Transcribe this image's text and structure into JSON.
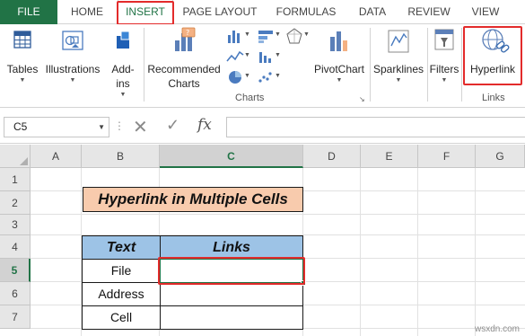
{
  "tabs": [
    {
      "label": "FILE"
    },
    {
      "label": "HOME"
    },
    {
      "label": "INSERT"
    },
    {
      "label": "PAGE LAYOUT"
    },
    {
      "label": "FORMULAS"
    },
    {
      "label": "DATA"
    },
    {
      "label": "REVIEW"
    },
    {
      "label": "VIEW"
    }
  ],
  "ribbon": {
    "tables": "Tables",
    "illustrations": "Illustrations",
    "addins_line1": "Add-",
    "addins_line2": "ins",
    "recommended_line1": "Recommended",
    "recommended_line2": "Charts",
    "pivotchart": "PivotChart",
    "sparklines": "Sparklines",
    "filters": "Filters",
    "hyperlink": "Hyperlink",
    "charts_group": "Charts",
    "links_group": "Links"
  },
  "formula_bar": {
    "name_box": "C5",
    "fx": "fx",
    "formula": ""
  },
  "sheet": {
    "columns": [
      "A",
      "B",
      "C",
      "D",
      "E",
      "F",
      "G"
    ],
    "rows": [
      "1",
      "2",
      "3",
      "4",
      "5",
      "6",
      "7"
    ],
    "title": "Hyperlink in Multiple Cells",
    "table_headers": [
      "Text",
      "Links"
    ],
    "table_rows": [
      {
        "text": "File",
        "link": ""
      },
      {
        "text": "Address",
        "link": ""
      },
      {
        "text": "Cell",
        "link": ""
      }
    ]
  },
  "watermark": "wsxdn.com",
  "colors": {
    "excel_green": "#217346",
    "highlight_red": "#e32b2b",
    "title_fill": "#f8cbad",
    "header_fill": "#9dc3e6"
  }
}
